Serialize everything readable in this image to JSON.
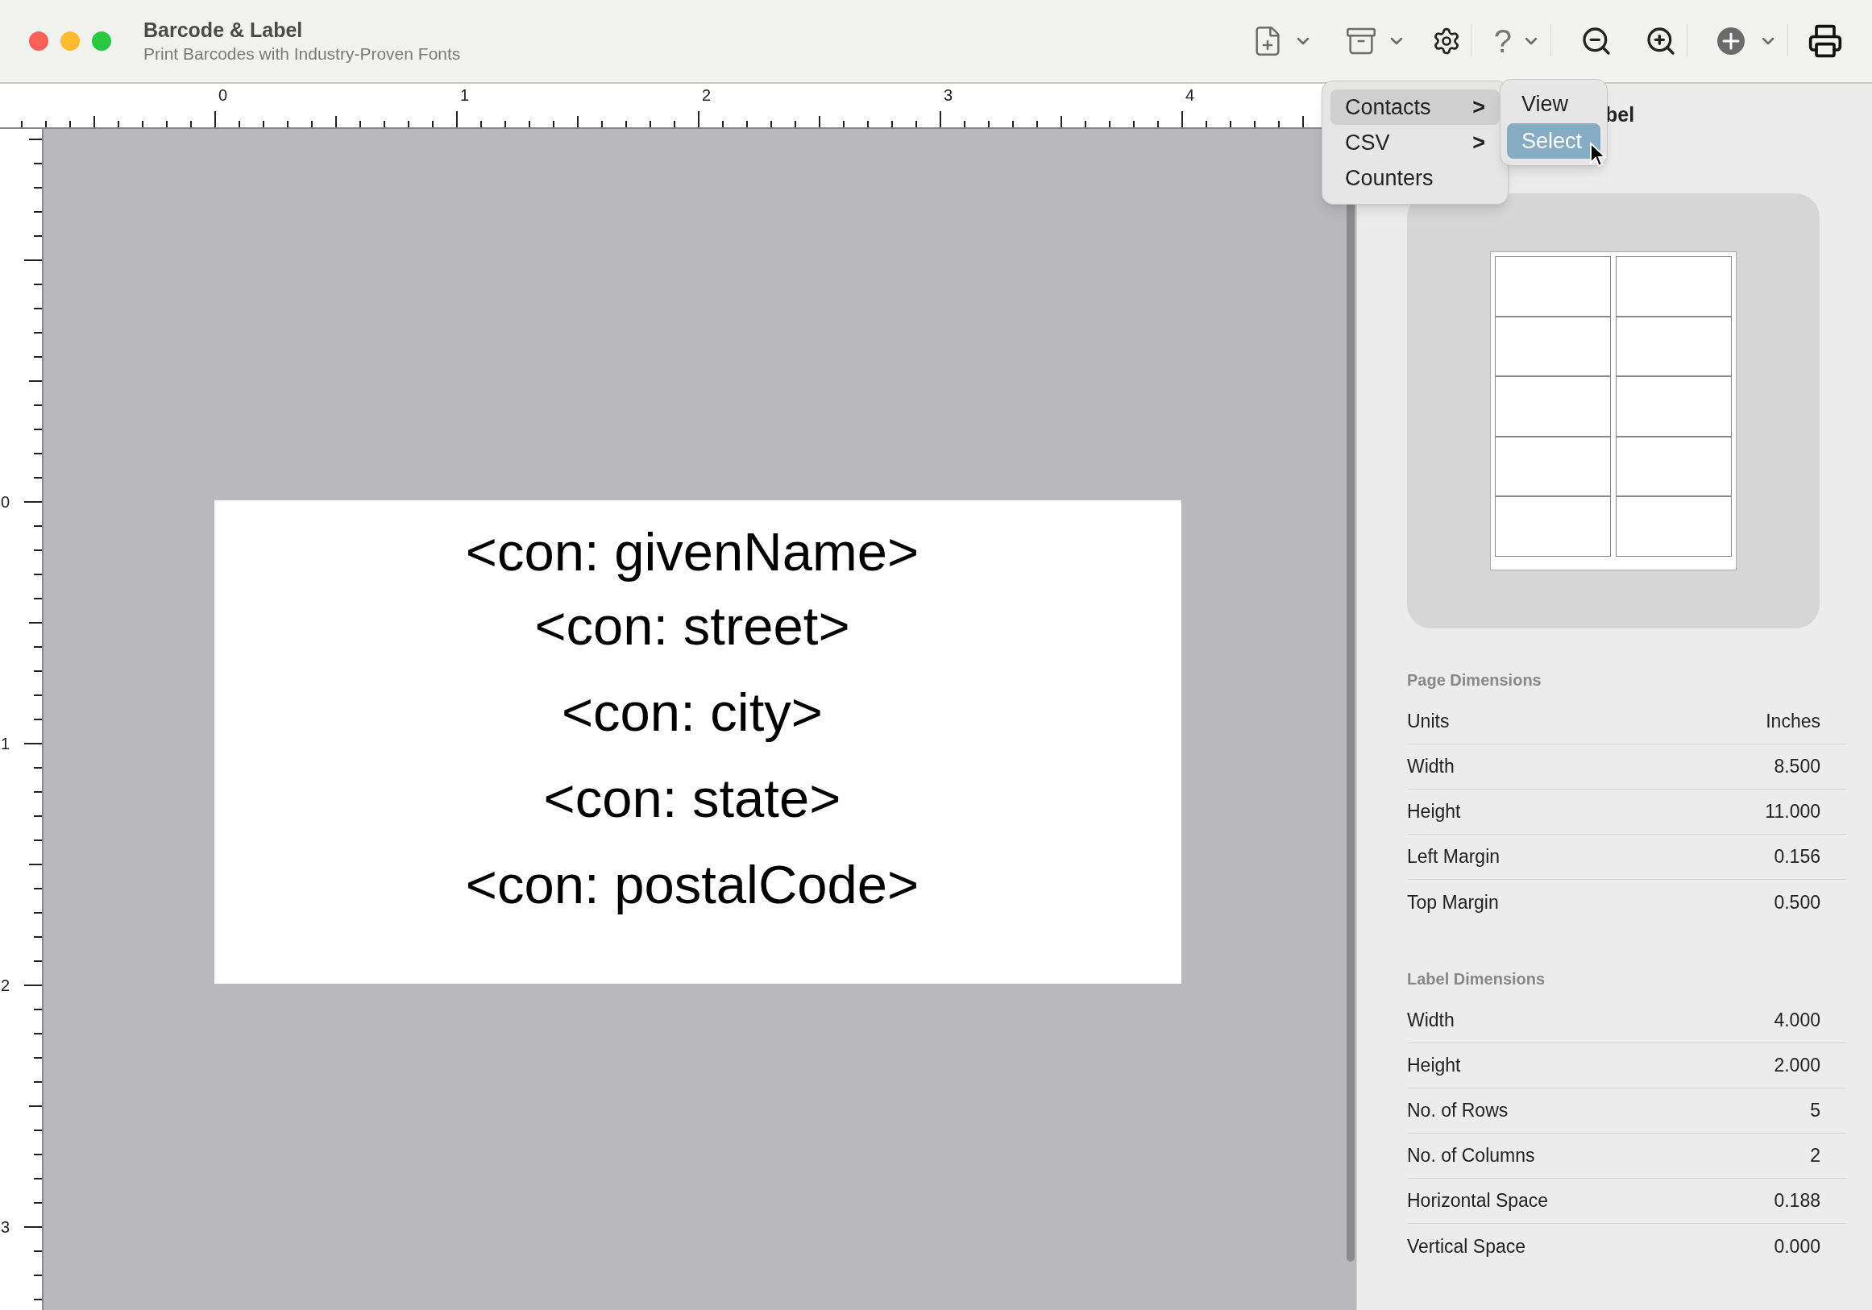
{
  "window": {
    "title": "Barcode & Label",
    "subtitle": "Print Barcodes with Industry-Proven Fonts"
  },
  "toolbar": {
    "help_glyph": "?"
  },
  "menu": {
    "items": [
      {
        "label": "Contacts",
        "submenu": true,
        "selected": true
      },
      {
        "label": "CSV",
        "submenu": true,
        "selected": false
      },
      {
        "label": "Counters",
        "submenu": false,
        "selected": false
      }
    ],
    "chevron": ">",
    "submenu": [
      {
        "label": "View",
        "selected": false
      },
      {
        "label": "Select",
        "selected": true
      }
    ]
  },
  "rulers": {
    "horizontal": [
      "0",
      "1",
      "2",
      "3",
      "4"
    ],
    "vertical": [
      "0",
      "1",
      "2",
      "3"
    ]
  },
  "label": {
    "lines": [
      "<con: givenName>",
      "<con: street>",
      "<con: city>",
      "<con: state>",
      "<con: postalCode>"
    ]
  },
  "sidebar": {
    "title": "bel",
    "sections": [
      {
        "heading": "Page Dimensions",
        "rows": [
          {
            "name": "Units",
            "value": "Inches"
          },
          {
            "name": "Width",
            "value": "8.500"
          },
          {
            "name": "Height",
            "value": "11.000"
          },
          {
            "name": "Left Margin",
            "value": "0.156"
          },
          {
            "name": "Top Margin",
            "value": "0.500"
          }
        ]
      },
      {
        "heading": "Label Dimensions",
        "rows": [
          {
            "name": "Width",
            "value": "4.000"
          },
          {
            "name": "Height",
            "value": "2.000"
          },
          {
            "name": "No. of Rows",
            "value": "5"
          },
          {
            "name": "No. of Columns",
            "value": "2"
          },
          {
            "name": "Horizontal Space",
            "value": "0.188"
          },
          {
            "name": "Vertical Space",
            "value": "0.000"
          }
        ]
      }
    ]
  }
}
